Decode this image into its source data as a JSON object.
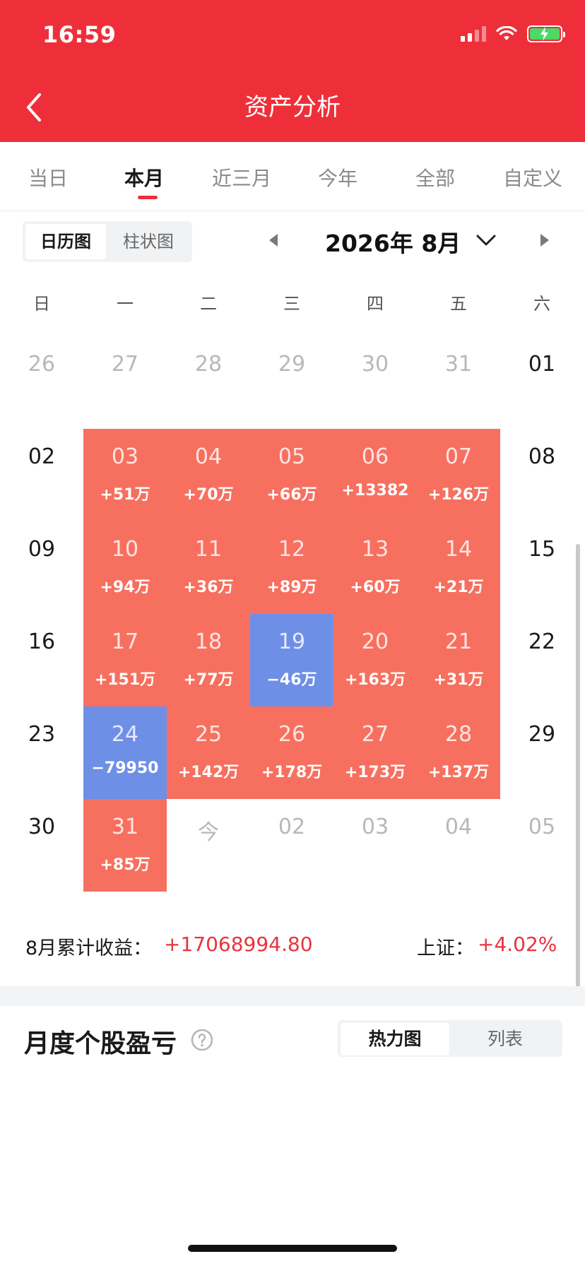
{
  "status_bar": {
    "time": "16:59"
  },
  "header": {
    "title": "资产分析"
  },
  "tabs": [
    {
      "label": "当日",
      "active": false
    },
    {
      "label": "本月",
      "active": true
    },
    {
      "label": "近三月",
      "active": false
    },
    {
      "label": "今年",
      "active": false
    },
    {
      "label": "全部",
      "active": false
    },
    {
      "label": "自定义",
      "active": false
    }
  ],
  "view_toggle": {
    "options": [
      "日历图",
      "柱状图"
    ],
    "selected": "日历图"
  },
  "month_nav": {
    "label": "2026年 8月"
  },
  "weekdays": [
    "日",
    "一",
    "二",
    "三",
    "四",
    "五",
    "六"
  ],
  "calendar": [
    [
      {
        "day": "26",
        "muted": true
      },
      {
        "day": "27",
        "muted": true
      },
      {
        "day": "28",
        "muted": true
      },
      {
        "day": "29",
        "muted": true
      },
      {
        "day": "30",
        "muted": true
      },
      {
        "day": "31",
        "muted": true
      },
      {
        "day": "01"
      }
    ],
    [
      {
        "day": "02"
      },
      {
        "day": "03",
        "pnl": "+51万",
        "trend": "up"
      },
      {
        "day": "04",
        "pnl": "+70万",
        "trend": "up"
      },
      {
        "day": "05",
        "pnl": "+66万",
        "trend": "up"
      },
      {
        "day": "06",
        "pnl": "+13382",
        "trend": "up"
      },
      {
        "day": "07",
        "pnl": "+126万",
        "trend": "up"
      },
      {
        "day": "08"
      }
    ],
    [
      {
        "day": "09"
      },
      {
        "day": "10",
        "pnl": "+94万",
        "trend": "up"
      },
      {
        "day": "11",
        "pnl": "+36万",
        "trend": "up"
      },
      {
        "day": "12",
        "pnl": "+89万",
        "trend": "up"
      },
      {
        "day": "13",
        "pnl": "+60万",
        "trend": "up"
      },
      {
        "day": "14",
        "pnl": "+21万",
        "trend": "up"
      },
      {
        "day": "15"
      }
    ],
    [
      {
        "day": "16"
      },
      {
        "day": "17",
        "pnl": "+151万",
        "trend": "up"
      },
      {
        "day": "18",
        "pnl": "+77万",
        "trend": "up"
      },
      {
        "day": "19",
        "pnl": "−46万",
        "trend": "down"
      },
      {
        "day": "20",
        "pnl": "+163万",
        "trend": "up"
      },
      {
        "day": "21",
        "pnl": "+31万",
        "trend": "up"
      },
      {
        "day": "22"
      }
    ],
    [
      {
        "day": "23"
      },
      {
        "day": "24",
        "pnl": "−79950",
        "trend": "down"
      },
      {
        "day": "25",
        "pnl": "+142万",
        "trend": "up"
      },
      {
        "day": "26",
        "pnl": "+178万",
        "trend": "up"
      },
      {
        "day": "27",
        "pnl": "+173万",
        "trend": "up"
      },
      {
        "day": "28",
        "pnl": "+137万",
        "trend": "up"
      },
      {
        "day": "29"
      }
    ],
    [
      {
        "day": "30"
      },
      {
        "day": "31",
        "pnl": "+85万",
        "trend": "up"
      },
      {
        "day": "今",
        "muted": true
      },
      {
        "day": "02",
        "muted": true
      },
      {
        "day": "03",
        "muted": true
      },
      {
        "day": "04",
        "muted": true
      },
      {
        "day": "05",
        "muted": true
      }
    ]
  ],
  "summary": {
    "label": "8月累计收益：",
    "value": "+17068994.80",
    "index_label": "上证：",
    "index_value": "+4.02%"
  },
  "monthly_section": {
    "title": "月度个股盈亏",
    "toggle_options": [
      "热力图",
      "列表"
    ],
    "selected": "热力图"
  },
  "colors": {
    "brand": "#ee2f3a",
    "gain_cell": "#f7705f",
    "loss_cell": "#6e8fe6",
    "gain_text": "#e8333c"
  },
  "icons": [
    "back-arrow-icon",
    "signal-icon",
    "wifi-icon",
    "battery-charging-icon",
    "caret-left-icon",
    "chevron-down-icon",
    "caret-right-icon",
    "question-circle-icon"
  ]
}
